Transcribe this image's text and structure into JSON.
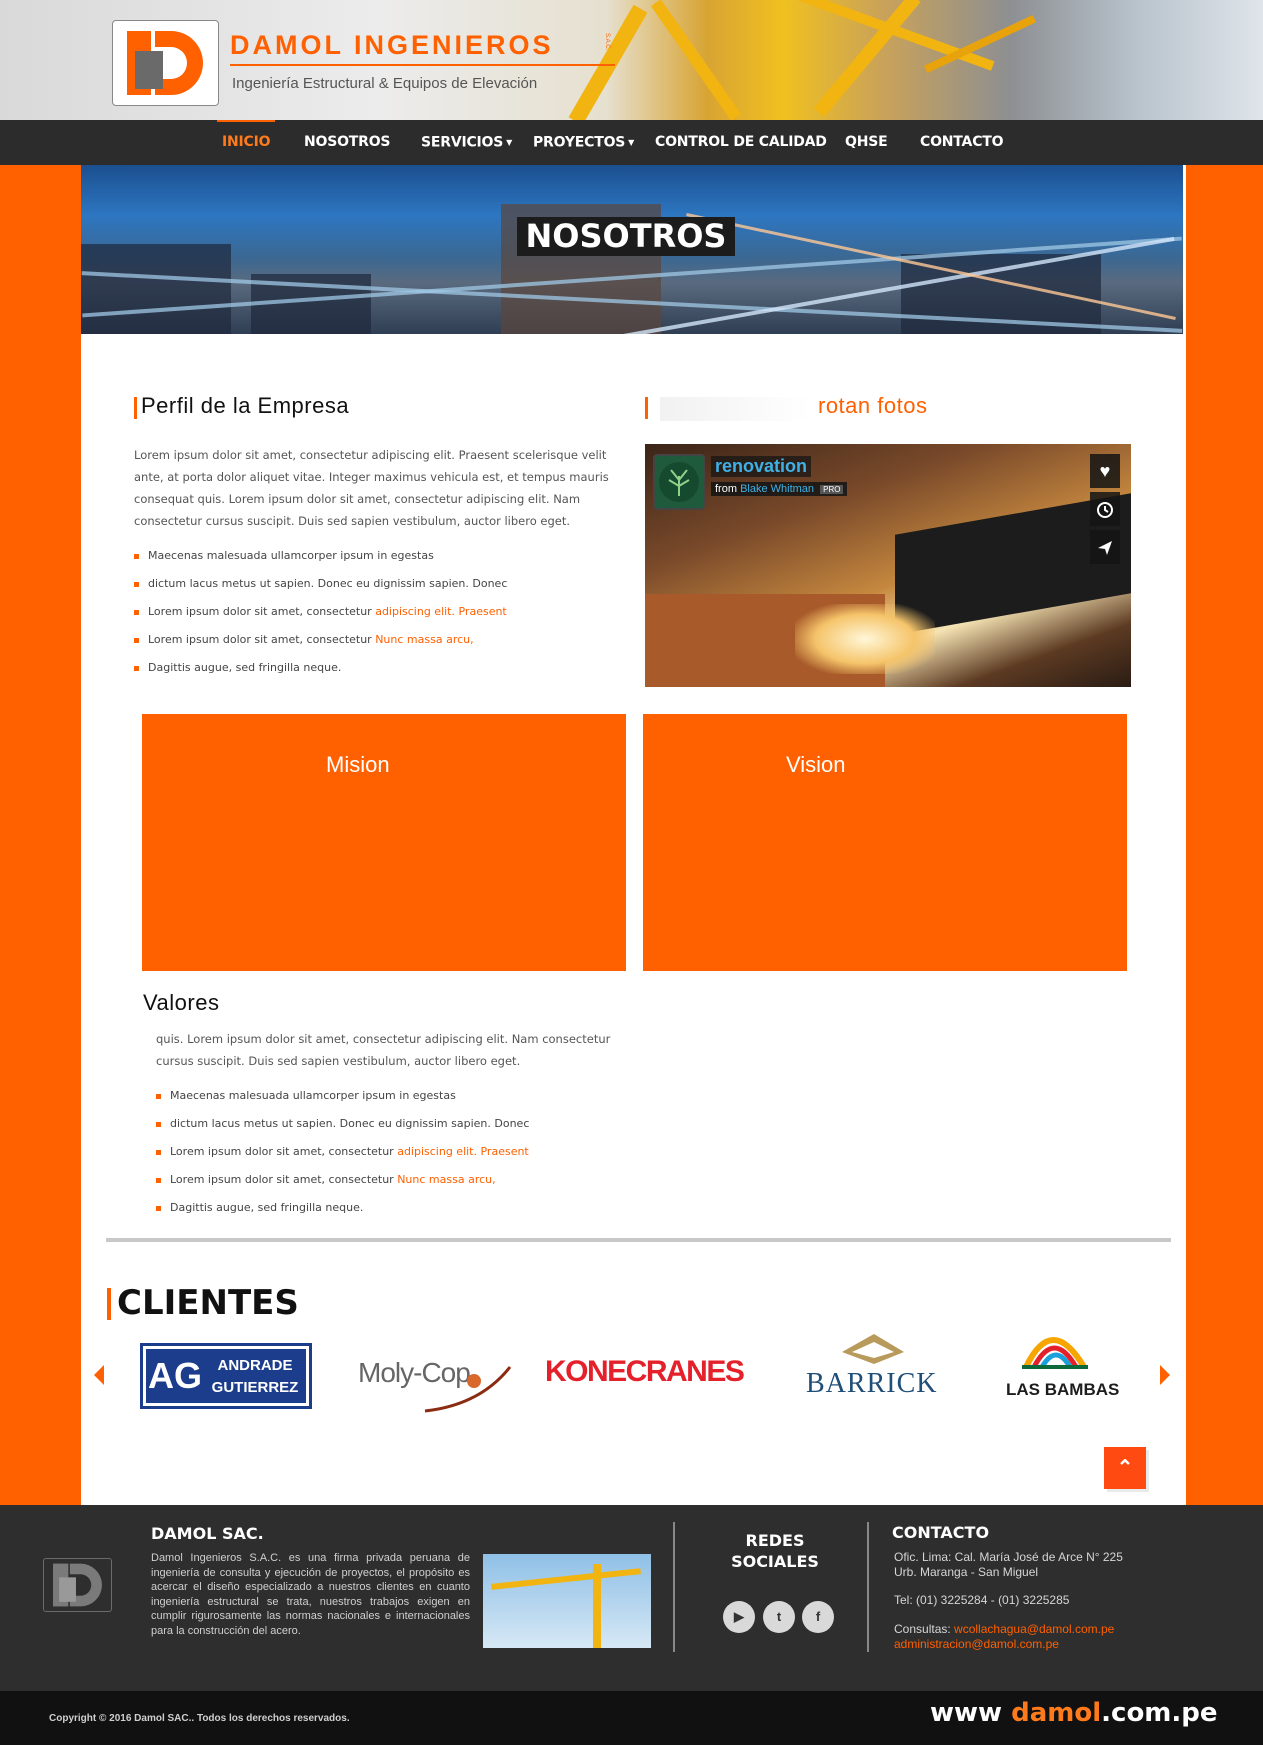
{
  "brand": {
    "name": "DAMOL INGENIEROS",
    "suffix": "S.A.C.",
    "tagline": "Ingeniería Estructural & Equipos de Elevación"
  },
  "nav": {
    "items": [
      {
        "label": "INICIO",
        "active": true
      },
      {
        "label": "NOSOTROS"
      },
      {
        "label": "SERVICIOS",
        "dropdown": true
      },
      {
        "label": "PROYECTOS",
        "dropdown": true
      },
      {
        "label": "CONTROL DE CALIDAD"
      },
      {
        "label": "QHSE"
      },
      {
        "label": "CONTACTO"
      }
    ]
  },
  "banner": {
    "title": "NOSOTROS"
  },
  "perfil": {
    "title": "Perfil de la Empresa",
    "paragraph": "Lorem ipsum dolor sit amet, consectetur adipiscing elit. Praesent scelerisque velit ante, at porta dolor aliquet vitae. Integer maximus vehicula est, et tempus mauris consequat quis. Lorem ipsum dolor sit amet, consectetur adipiscing elit. Nam consectetur cursus suscipit. Duis sed sapien vestibulum, auctor libero eget.",
    "list": [
      {
        "text": "Maecenas malesuada ullamcorper ipsum in egestas",
        "link": ""
      },
      {
        "text": "dictum lacus metus ut sapien. Donec eu dignissim sapien. Donec",
        "link": ""
      },
      {
        "text": "Lorem ipsum dolor sit amet, consectetur ",
        "link": "adipiscing elit. Praesent"
      },
      {
        "text": "Lorem ipsum dolor sit amet, consectetur ",
        "link": "Nunc massa arcu,"
      },
      {
        "text": "Dagittis augue, sed fringilla neque.",
        "link": ""
      }
    ]
  },
  "fotos": {
    "title": "rotan fotos",
    "video": {
      "title": "renovation",
      "from": "from",
      "author": "Blake Whitman",
      "badge": "PRO"
    }
  },
  "boxes": {
    "mision": "Mision",
    "vision": "Vision"
  },
  "valores": {
    "title": "Valores",
    "paragraph": "quis. Lorem ipsum dolor sit amet, consectetur adipiscing elit. Nam consectetur cursus suscipit. Duis sed sapien vestibulum, auctor libero eget.",
    "list": [
      {
        "text": "Maecenas malesuada ullamcorper ipsum in egestas",
        "link": ""
      },
      {
        "text": "dictum lacus metus ut sapien. Donec eu dignissim sapien. Donec",
        "link": ""
      },
      {
        "text": "Lorem ipsum dolor sit amet, consectetur ",
        "link": "adipiscing elit. Praesent"
      },
      {
        "text": "Lorem ipsum dolor sit amet, consectetur ",
        "link": "Nunc massa arcu,"
      },
      {
        "text": "Dagittis augue, sed fringilla neque.",
        "link": ""
      }
    ]
  },
  "clientes": {
    "title": "CLIENTES",
    "logos": {
      "ag_mark": "AG",
      "ag_line1": "ANDRADE",
      "ag_line2": "GUTIERREZ",
      "moly": "Moly-Cop",
      "konecranes": "KONECRANES",
      "barrick": "BARRICK",
      "lasbambas": "LAS BAMBAS"
    }
  },
  "footer": {
    "company_title": "DAMOL SAC.",
    "company_text": "Damol Ingenieros S.A.C. es una firma privada peruana de ingeniería de consulta y ejecución de proyectos, el propósito es acercar el diseño especializado a nuestros clientes en cuanto ingeniería estructural se trata, nuestros trabajos exigen en cumplir rigurosamente las normas nacionales e internacionales para la construcción del acero.",
    "social_title_1": "REDES",
    "social_title_2": "SOCIALES",
    "contact_title": "CONTACTO",
    "address_1": "Ofic. Lima: Cal. María José de Arce N° 225",
    "address_2": "Urb. Maranga - San Miguel",
    "phone": "Tel: (01) 3225284 - (01) 3225285",
    "consultas_label": "Consultas:",
    "email_1": "wcollachagua@damol.com.pe",
    "email_2": "administracion@damol.com.pe",
    "copyright": "Copyright © 2016 Damol SAC.. Todos los derechos reservados.",
    "site_prefix": "www ",
    "site_highlight": "damol",
    "site_suffix": ".com.pe"
  },
  "colors": {
    "accent": "#ff6000",
    "dark": "#2c2c2c",
    "footer": "#2e2e2e",
    "link_blue": "#3fb1e6"
  }
}
